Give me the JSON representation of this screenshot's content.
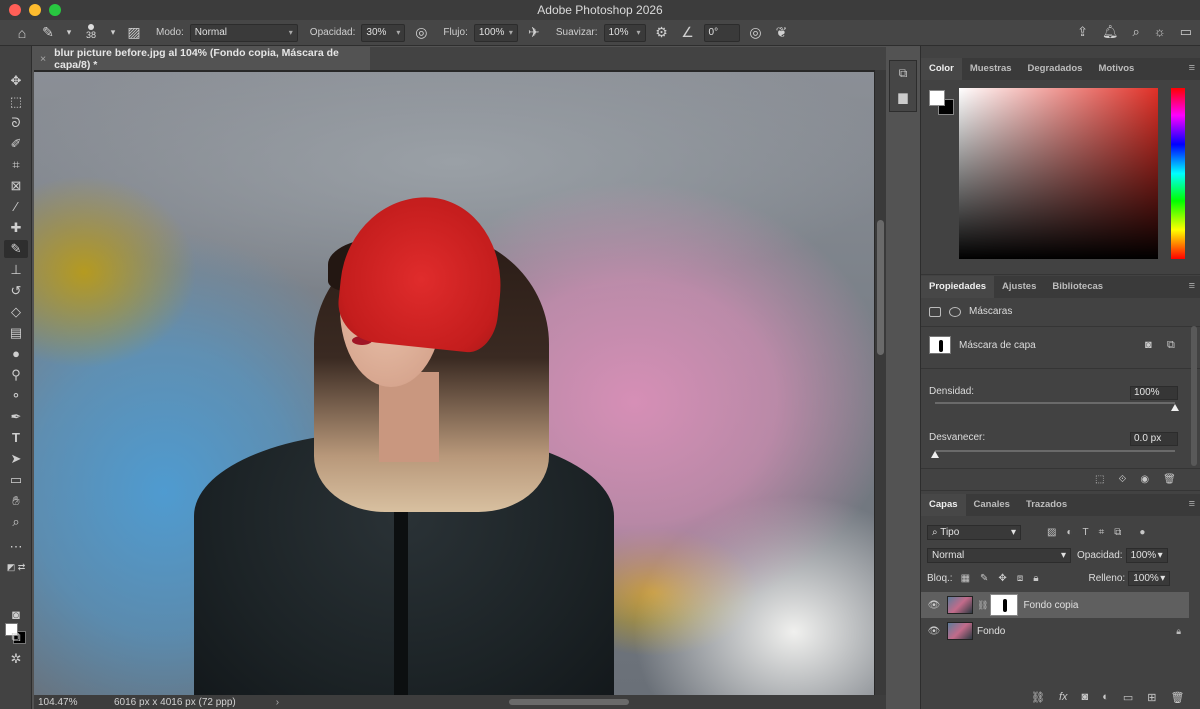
{
  "window": {
    "title": "Adobe Photoshop 2026"
  },
  "options_bar": {
    "brush_size": "38",
    "mode_label": "Modo:",
    "mode_value": "Normal",
    "opacity_label": "Opacidad:",
    "opacity_value": "30%",
    "flow_label": "Flujo:",
    "flow_value": "100%",
    "smoothing_label": "Suavizar:",
    "smoothing_value": "10%",
    "angle_value": "0°"
  },
  "document": {
    "tab_title": "blur picture before.jpg al 104% (Fondo copia, Máscara de capa/8) *",
    "close_symbol": "×"
  },
  "status_bar": {
    "zoom": "104.47%",
    "dimensions": "6016 px x 4016 px (72 ppp)",
    "arrow": "›"
  },
  "color_panel": {
    "tabs": [
      "Color",
      "Muestras",
      "Degradados",
      "Motivos"
    ],
    "foreground": "#ffffff",
    "background": "#000000",
    "hue_color": "#e03027"
  },
  "properties_panel": {
    "tabs": [
      "Propiedades",
      "Ajustes",
      "Bibliotecas"
    ],
    "section": "Máscaras",
    "mask_type": "Máscara de capa",
    "density_label": "Densidad:",
    "density_value": "100%",
    "density_level": 1.0,
    "feather_label": "Desvanecer:",
    "feather_value": "0.0 px",
    "feather_level": 0.0
  },
  "layers_panel": {
    "tabs": [
      "Capas",
      "Canales",
      "Trazados"
    ],
    "filter_kind": "Tipo",
    "blend_mode": "Normal",
    "opacity_label": "Opacidad:",
    "opacity_value": "100%",
    "lock_label": "Bloq.:",
    "fill_label": "Relleno:",
    "fill_value": "100%",
    "layers": [
      {
        "name": "Fondo copia",
        "selected": true,
        "has_mask": true
      },
      {
        "name": "Fondo",
        "selected": false,
        "locked": true
      }
    ]
  }
}
